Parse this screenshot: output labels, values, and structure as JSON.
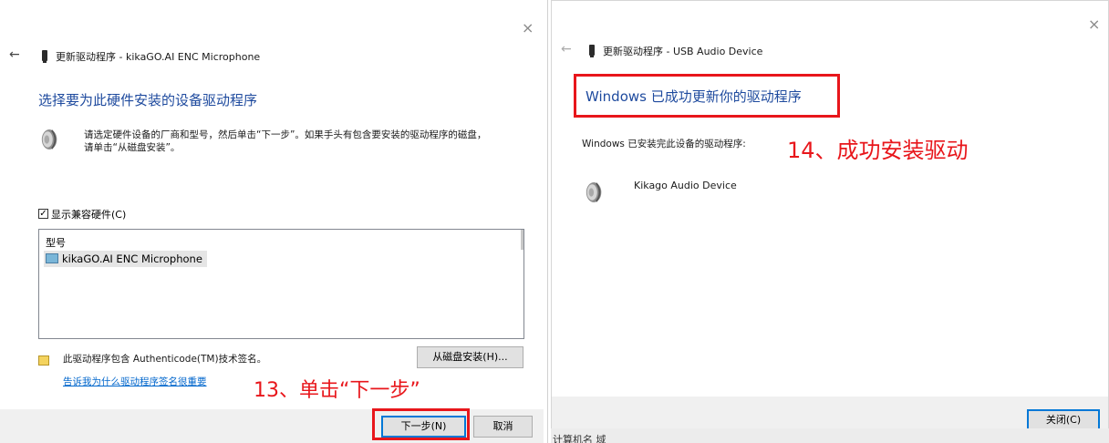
{
  "left_dialog": {
    "close_glyph": "×",
    "back_glyph": "←",
    "title": "更新驱动程序 - kikaGO.AI ENC Microphone",
    "heading": "选择要为此硬件安装的设备驱动程序",
    "instruction_line1": "请选定硬件设备的厂商和型号，然后单击“下一步”。如果手头有包含要安装的驱动程序的磁盘，",
    "instruction_line2": "请单击“从磁盘安装”。",
    "show_compatible_label": "显示兼容硬件(C)",
    "checkbox_glyph": "✓",
    "list_header": "型号",
    "list_items": [
      "kikaGO.AI ENC Microphone"
    ],
    "signature_text": "此驱动程序包含 Authenticode(TM)技术签名。",
    "have_disk_button": "从磁盘安装(H)...",
    "why_signing_link": "告诉我为什么驱动程序签名很重要",
    "next_button": "下一步(N)",
    "cancel_button": "取消"
  },
  "right_dialog": {
    "close_glyph": "×",
    "back_glyph": "←",
    "title": "更新驱动程序 - USB Audio Device",
    "heading": "Windows 已成功更新你的驱动程序",
    "installed_text": "Windows 已安装完此设备的驱动程序:",
    "device_name": "Kikago Audio Device",
    "close_button": "关闭(C)"
  },
  "annotations": {
    "step13": "13、单击“下一步”",
    "step14": "14、成功安装驱动"
  },
  "background_fragment": "计算机名 域",
  "colors": {
    "heading_blue": "#1e4a9e",
    "annotation_red": "#e8161b",
    "link_blue": "#0066cc",
    "footer_gray": "#f0f0f0"
  },
  "icons": {
    "speaker": "speaker-icon",
    "device": "device-title-icon",
    "certificate": "certificate-icon",
    "driver_item": "driver-item-icon"
  }
}
